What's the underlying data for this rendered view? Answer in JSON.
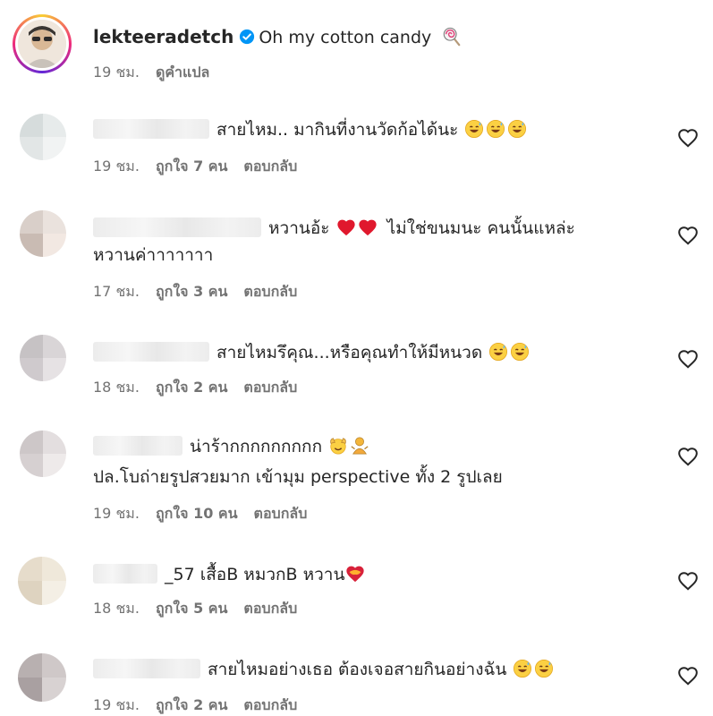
{
  "post": {
    "username": "lekteeradetch",
    "caption": "Oh my cotton candy",
    "time": "19 ชม.",
    "translate": "ดูคำแปล",
    "verified": true
  },
  "comments": [
    {
      "lines": [
        "สายไหม.. มากินที่งานวัดก้อได้นะ"
      ],
      "emojis": [
        "grin-sweat",
        "grin-sweat",
        "grin-sweat"
      ],
      "time": "19 ชม.",
      "likes": "ถูกใจ 7 คน",
      "reply": "ตอบกลับ",
      "avatar_colors": [
        "#d6dcdc",
        "#e7ebeb",
        "#e2e6e6",
        "#f1f3f3"
      ]
    },
    {
      "lines": [
        "หวานอ้ะ",
        "ไม่ใช่ขนมนะ คนนั้นแหล่ะ",
        "หวานค่าาาาาาา"
      ],
      "emojis": [
        "red-heart",
        "red-heart"
      ],
      "time": "17 ชม.",
      "likes": "ถูกใจ 3 คน",
      "reply": "ตอบกลับ",
      "avatar_colors": [
        "#d9cfc9",
        "#eae2dd",
        "#c9bbb3",
        "#f2e8e2"
      ]
    },
    {
      "lines": [
        "สายไหมรึคุณ...หรือคุณทำให้มีหนวด"
      ],
      "emojis": [
        "grin-sweat",
        "grin-sweat"
      ],
      "time": "18 ชม.",
      "likes": "ถูกใจ 2 คน",
      "reply": "ตอบกลับ",
      "avatar_colors": [
        "#c6c2c4",
        "#d9d5d7",
        "#cfcacd",
        "#e6e2e4"
      ]
    },
    {
      "lines": [
        "น่าร้ากกกกกกกกก",
        "ปล.โบถ่ายรูปสวยมาก เข้ามุม perspective ทั้ง 2 รูปเลย"
      ],
      "emojis": [
        "raised-hands-face",
        "bowing-person"
      ],
      "time": "19 ชม.",
      "likes": "ถูกใจ 10 คน",
      "reply": "ตอบกลับ",
      "avatar_colors": [
        "#cdc7c8",
        "#e3dedf",
        "#d6d0d1",
        "#eeeaea"
      ]
    },
    {
      "lines": [
        "_57 เสื้อB หมวกB หวาน"
      ],
      "emojis": [
        "heart-on-fire"
      ],
      "time": "18 ชม.",
      "likes": "ถูกใจ 5 คน",
      "reply": "ตอบกลับ",
      "avatar_colors": [
        "#e6dccb",
        "#efe8da",
        "#ded3c0",
        "#f4efe5"
      ]
    },
    {
      "lines": [
        "สายไหมอย่างเธอ ต้องเจอสายกินอย่างฉัน"
      ],
      "emojis": [
        "grin-sweat",
        "grin-sweat"
      ],
      "time": "19 ชม.",
      "likes": "ถูกใจ 2 คน",
      "reply": "ตอบกลับ",
      "avatar_colors": [
        "#b8b0b0",
        "#cfc8c8",
        "#a9a0a1",
        "#d8d2d2"
      ]
    }
  ],
  "colors": {
    "text": "#262626",
    "meta": "#737373",
    "verified": "#0095f6",
    "heart_outline": "#262626"
  },
  "icons": {
    "verified": "verified-badge-icon",
    "like": "heart-outline-icon",
    "caption_emoji": "lollipop"
  }
}
